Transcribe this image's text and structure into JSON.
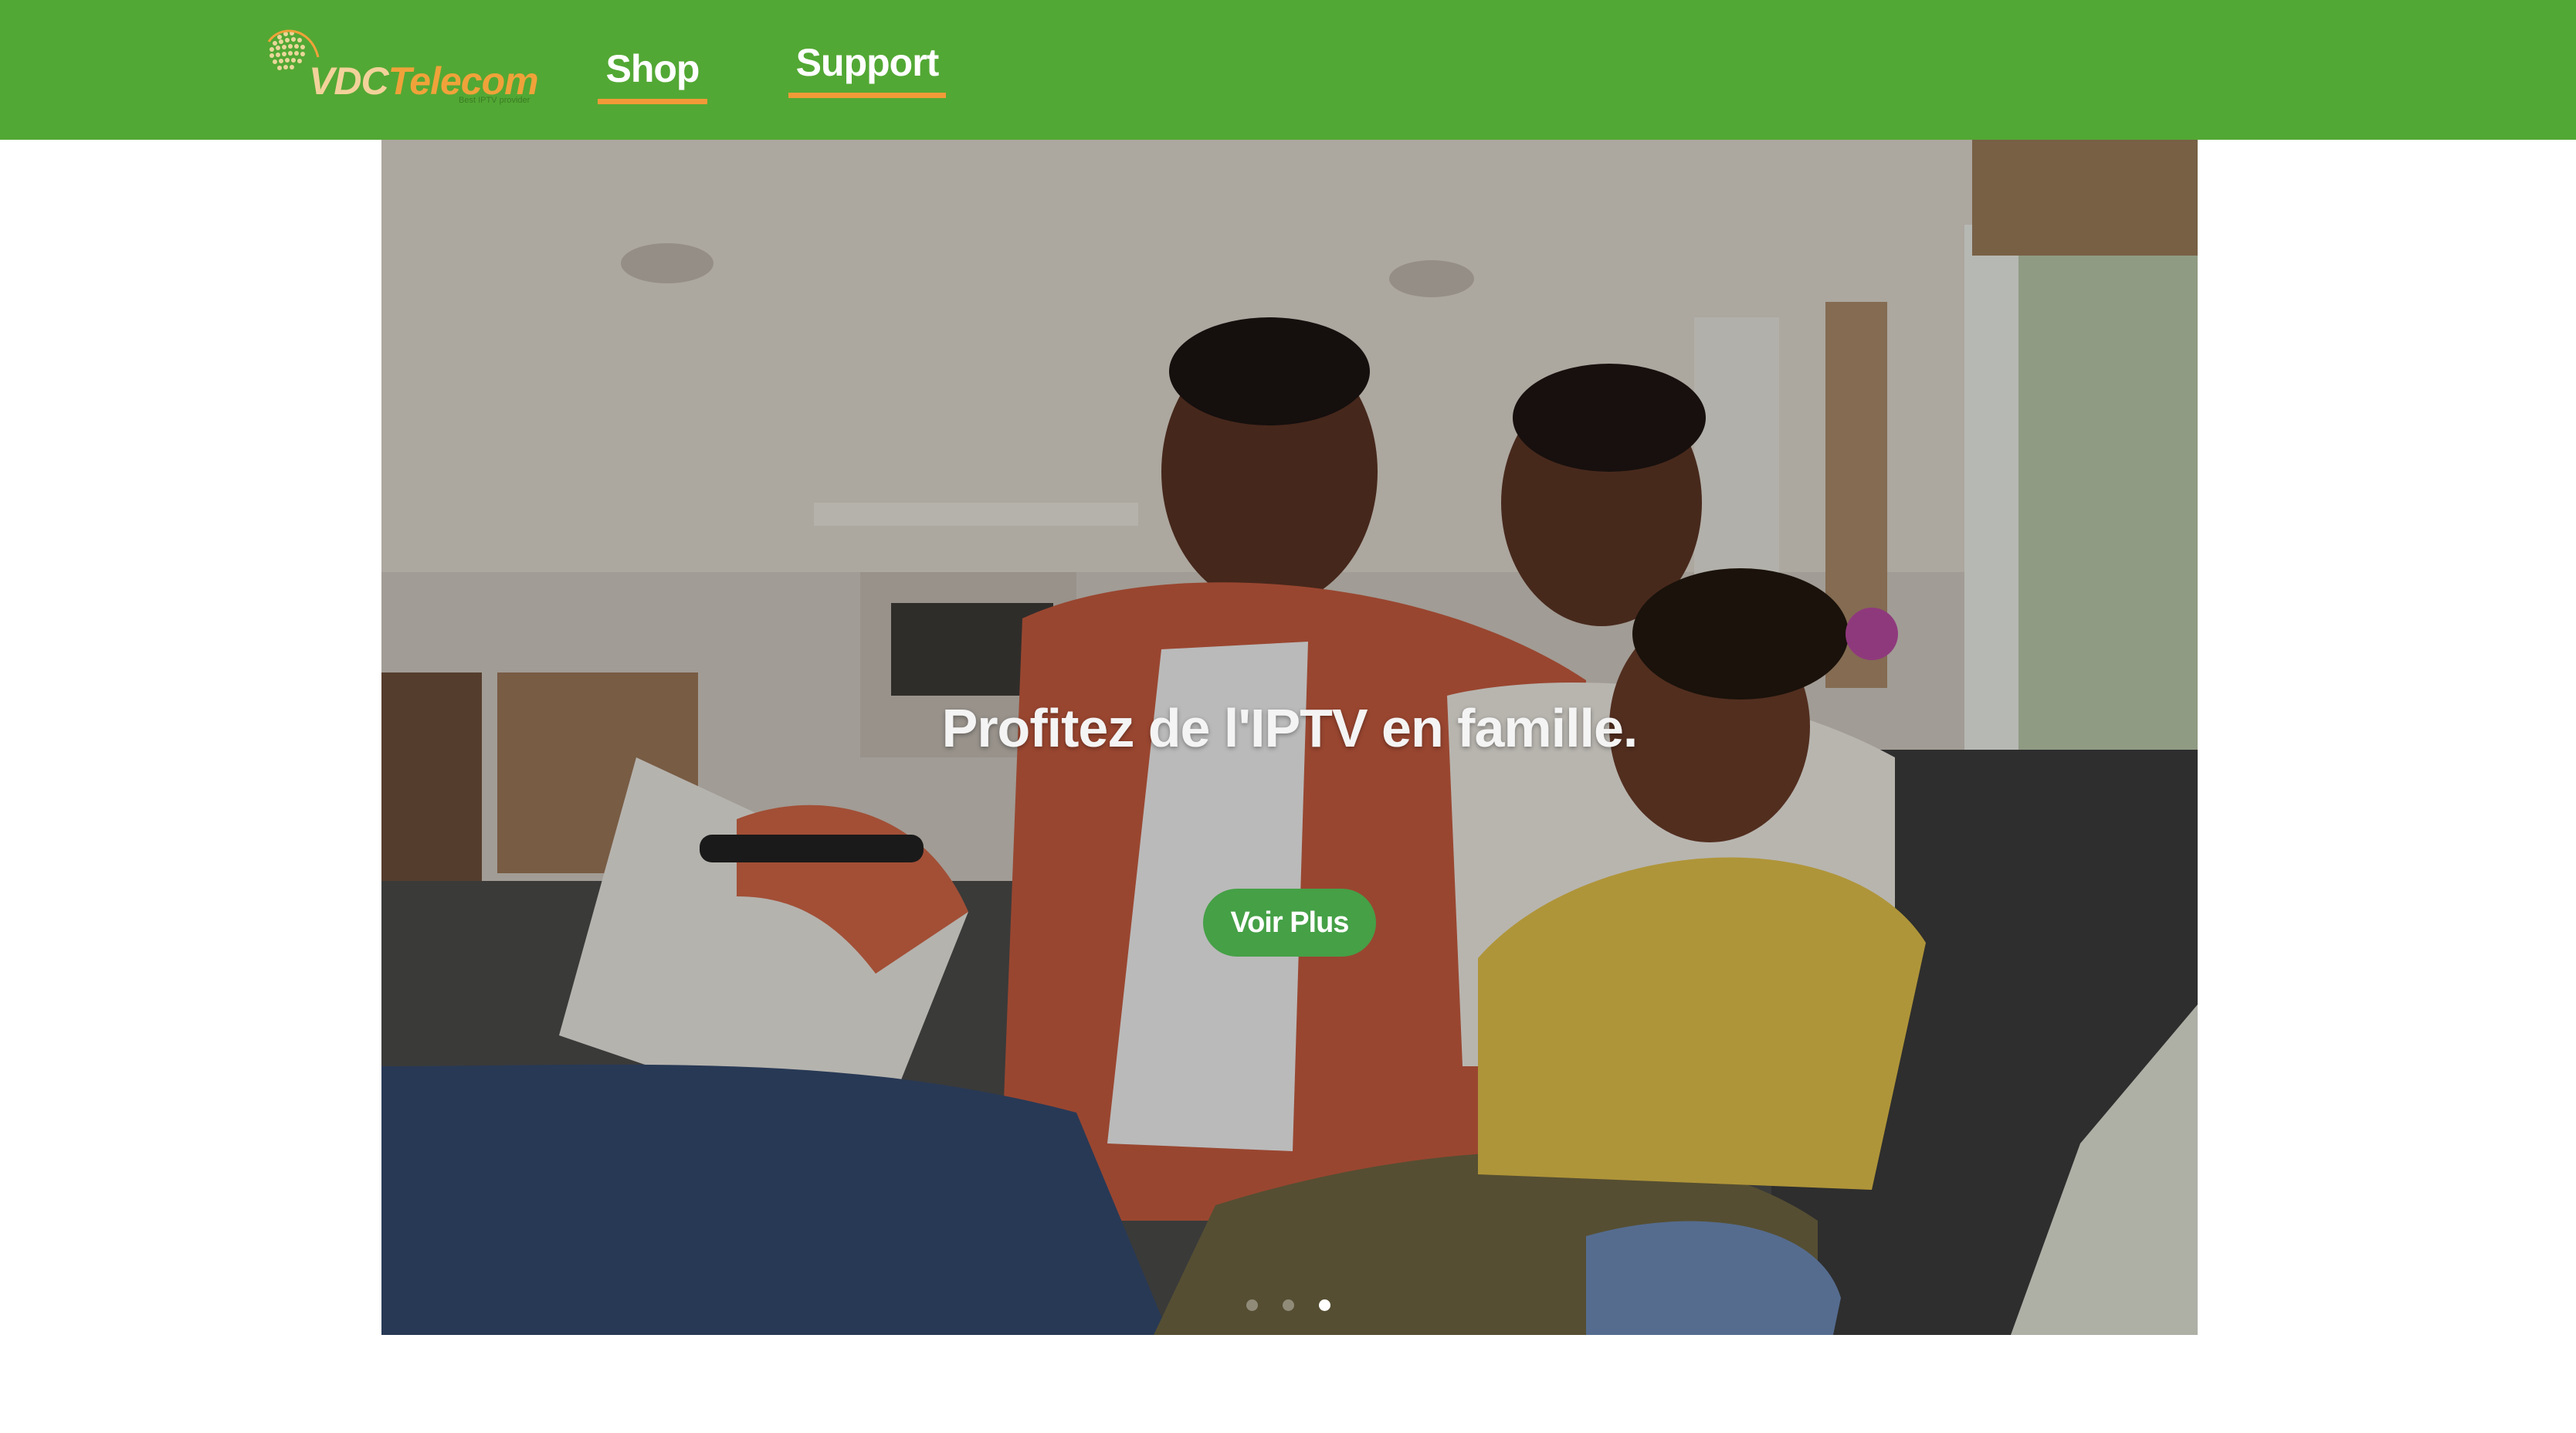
{
  "header": {
    "logo": {
      "brand_part1": "VDC",
      "brand_part2": "Telecom",
      "tagline": "Best IPTV provider",
      "icon": "globe-icon"
    },
    "nav": [
      {
        "label": "Shop",
        "active": true
      },
      {
        "label": "Support",
        "active": true
      }
    ],
    "colors": {
      "navbar_bg": "#52a834",
      "nav_underline": "#f29a38"
    }
  },
  "hero": {
    "title": "Profitez de l'IPTV en famille.",
    "button_label": "Voir Plus",
    "button_color": "#45a046",
    "carousel": {
      "slide_count": 3,
      "active_index": 3
    }
  }
}
